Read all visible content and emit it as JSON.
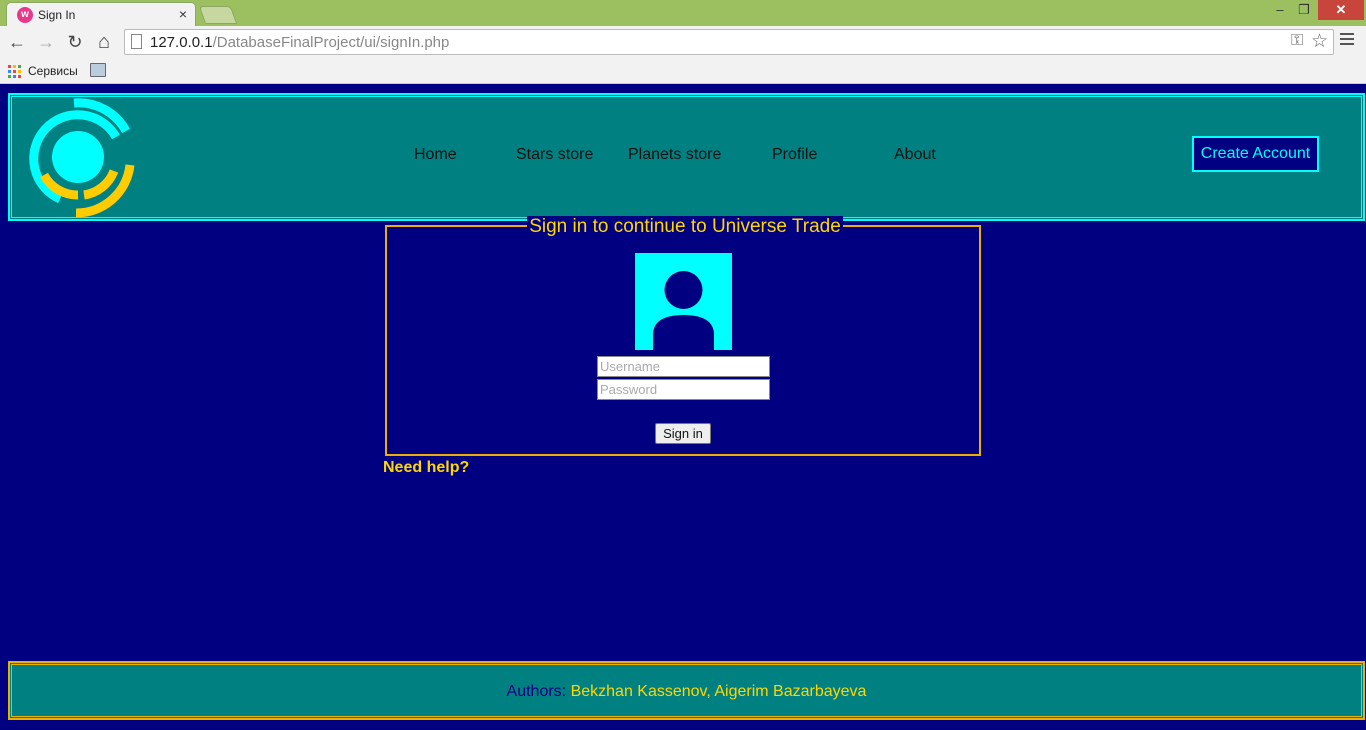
{
  "browser": {
    "tab_title": "Sign In",
    "tab_close": "×",
    "favicon_letter": "w",
    "controls": {
      "minimize": "–",
      "maximize": "❐",
      "close": "✕"
    },
    "nav": {
      "back": "←",
      "forward": "→",
      "reload": "↻",
      "home": "⌂"
    },
    "url_host": "127.0.0.1",
    "url_path": "/DatabaseFinalProject/ui/signIn.php",
    "bookmarks_label": "Сервисы"
  },
  "header": {
    "nav_items": [
      "Home",
      "Stars store",
      "Planets store",
      "Profile",
      "About"
    ],
    "create_account": "Create Account"
  },
  "signin": {
    "legend": "Sign in to continue to Universe Trade",
    "username_placeholder": "Username",
    "password_placeholder": "Password",
    "button": "Sign in",
    "help": "Need help?"
  },
  "footer": {
    "label": "Authors:",
    "names": "Bekzhan Kassenov, Aigerim Bazarbayeva"
  },
  "colors": {
    "page_bg": "#000080",
    "header_bg": "#008080",
    "accent_cyan": "#00ffff",
    "accent_gold": "#ffd700"
  }
}
